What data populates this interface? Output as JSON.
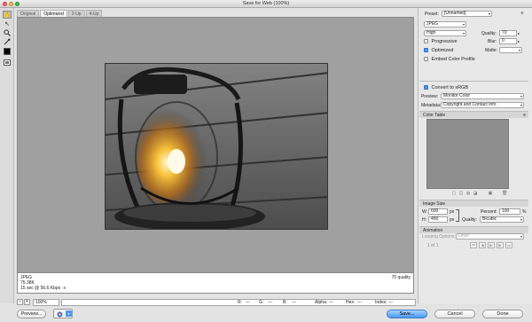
{
  "window": {
    "title": "Save for Web (100%)",
    "traffic_colors": [
      "#fc605c",
      "#fdbc40",
      "#34c84a"
    ]
  },
  "tabs": [
    {
      "label": "Original",
      "active": false
    },
    {
      "label": "Optimized",
      "active": true
    },
    {
      "label": "2-Up",
      "active": false
    },
    {
      "label": "4-Up",
      "active": false
    }
  ],
  "tools": [
    {
      "icon": "hand-icon",
      "glyph": "✋"
    },
    {
      "icon": "slice-select-icon",
      "glyph": "↖"
    },
    {
      "icon": "zoom-icon",
      "glyph": "🔍"
    },
    {
      "icon": "eyedropper-icon",
      "glyph": "✎"
    }
  ],
  "preview_info": {
    "format": "JPEG",
    "size": "75.38K",
    "speed": "15 sec @ 56.6 Kbps",
    "speed_menu": "≡",
    "quality": "70 quality"
  },
  "status": {
    "zoom": "100%",
    "r": "R:",
    "r_val": "---",
    "g": "G:",
    "g_val": "---",
    "b": "B:",
    "b_val": "---",
    "alpha": "Alpha:",
    "alpha_val": "---",
    "hex": "Hex:",
    "hex_val": "---",
    "index": "Index:",
    "index_val": "---"
  },
  "buttons": {
    "preview": "Preview...",
    "save": "Save...",
    "cancel": "Cancel",
    "done": "Done"
  },
  "panel": {
    "preset_label": "Preset:",
    "preset_value": "[Unnamed]",
    "format_value": "JPEG",
    "quality_level": "High",
    "quality_label": "Quality:",
    "quality_value": "70",
    "progressive_label": "Progressive",
    "progressive_checked": false,
    "blur_label": "Blur:",
    "blur_value": "0",
    "optimized_label": "Optimized",
    "optimized_checked": true,
    "matte_label": "Matte:",
    "embed_label": "Embed Color Profile",
    "embed_checked": false,
    "convert_label": "Convert to sRGB",
    "convert_checked": true,
    "preview_label": "Preview:",
    "preview_value": "Monitor Color",
    "metadata_label": "Metadata:",
    "metadata_value": "Copyright and Contact Info",
    "color_table_label": "Color Table",
    "image_size_label": "Image Size",
    "w_label": "W:",
    "w_value": "600",
    "h_label": "H:",
    "h_value": "450",
    "px": "px",
    "percent_label": "Percent:",
    "percent_value": "100",
    "percent_unit": "%",
    "resample_label": "Quality:",
    "resample_value": "Bicubic",
    "animation_label": "Animation",
    "looping_label": "Looping Options:",
    "looping_value": "Once",
    "frame_counter": "1 of 1"
  }
}
